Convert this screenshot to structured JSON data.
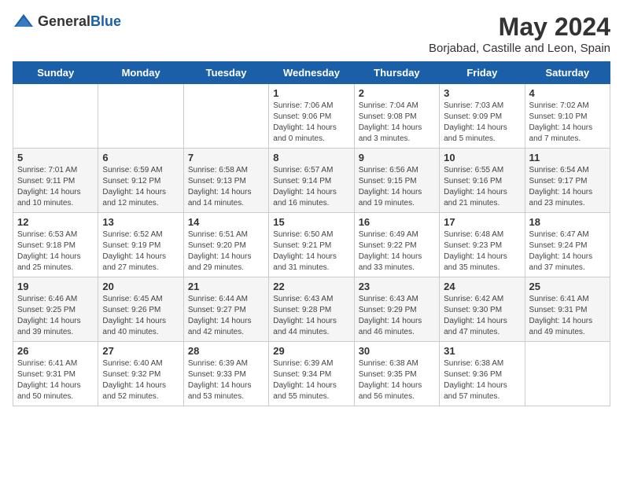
{
  "header": {
    "logo_general": "General",
    "logo_blue": "Blue",
    "month_title": "May 2024",
    "location": "Borjabad, Castille and Leon, Spain"
  },
  "weekdays": [
    "Sunday",
    "Monday",
    "Tuesday",
    "Wednesday",
    "Thursday",
    "Friday",
    "Saturday"
  ],
  "weeks": [
    [
      {
        "day": "",
        "info": ""
      },
      {
        "day": "",
        "info": ""
      },
      {
        "day": "",
        "info": ""
      },
      {
        "day": "1",
        "info": "Sunrise: 7:06 AM\nSunset: 9:06 PM\nDaylight: 14 hours\nand 0 minutes."
      },
      {
        "day": "2",
        "info": "Sunrise: 7:04 AM\nSunset: 9:08 PM\nDaylight: 14 hours\nand 3 minutes."
      },
      {
        "day": "3",
        "info": "Sunrise: 7:03 AM\nSunset: 9:09 PM\nDaylight: 14 hours\nand 5 minutes."
      },
      {
        "day": "4",
        "info": "Sunrise: 7:02 AM\nSunset: 9:10 PM\nDaylight: 14 hours\nand 7 minutes."
      }
    ],
    [
      {
        "day": "5",
        "info": "Sunrise: 7:01 AM\nSunset: 9:11 PM\nDaylight: 14 hours\nand 10 minutes."
      },
      {
        "day": "6",
        "info": "Sunrise: 6:59 AM\nSunset: 9:12 PM\nDaylight: 14 hours\nand 12 minutes."
      },
      {
        "day": "7",
        "info": "Sunrise: 6:58 AM\nSunset: 9:13 PM\nDaylight: 14 hours\nand 14 minutes."
      },
      {
        "day": "8",
        "info": "Sunrise: 6:57 AM\nSunset: 9:14 PM\nDaylight: 14 hours\nand 16 minutes."
      },
      {
        "day": "9",
        "info": "Sunrise: 6:56 AM\nSunset: 9:15 PM\nDaylight: 14 hours\nand 19 minutes."
      },
      {
        "day": "10",
        "info": "Sunrise: 6:55 AM\nSunset: 9:16 PM\nDaylight: 14 hours\nand 21 minutes."
      },
      {
        "day": "11",
        "info": "Sunrise: 6:54 AM\nSunset: 9:17 PM\nDaylight: 14 hours\nand 23 minutes."
      }
    ],
    [
      {
        "day": "12",
        "info": "Sunrise: 6:53 AM\nSunset: 9:18 PM\nDaylight: 14 hours\nand 25 minutes."
      },
      {
        "day": "13",
        "info": "Sunrise: 6:52 AM\nSunset: 9:19 PM\nDaylight: 14 hours\nand 27 minutes."
      },
      {
        "day": "14",
        "info": "Sunrise: 6:51 AM\nSunset: 9:20 PM\nDaylight: 14 hours\nand 29 minutes."
      },
      {
        "day": "15",
        "info": "Sunrise: 6:50 AM\nSunset: 9:21 PM\nDaylight: 14 hours\nand 31 minutes."
      },
      {
        "day": "16",
        "info": "Sunrise: 6:49 AM\nSunset: 9:22 PM\nDaylight: 14 hours\nand 33 minutes."
      },
      {
        "day": "17",
        "info": "Sunrise: 6:48 AM\nSunset: 9:23 PM\nDaylight: 14 hours\nand 35 minutes."
      },
      {
        "day": "18",
        "info": "Sunrise: 6:47 AM\nSunset: 9:24 PM\nDaylight: 14 hours\nand 37 minutes."
      }
    ],
    [
      {
        "day": "19",
        "info": "Sunrise: 6:46 AM\nSunset: 9:25 PM\nDaylight: 14 hours\nand 39 minutes."
      },
      {
        "day": "20",
        "info": "Sunrise: 6:45 AM\nSunset: 9:26 PM\nDaylight: 14 hours\nand 40 minutes."
      },
      {
        "day": "21",
        "info": "Sunrise: 6:44 AM\nSunset: 9:27 PM\nDaylight: 14 hours\nand 42 minutes."
      },
      {
        "day": "22",
        "info": "Sunrise: 6:43 AM\nSunset: 9:28 PM\nDaylight: 14 hours\nand 44 minutes."
      },
      {
        "day": "23",
        "info": "Sunrise: 6:43 AM\nSunset: 9:29 PM\nDaylight: 14 hours\nand 46 minutes."
      },
      {
        "day": "24",
        "info": "Sunrise: 6:42 AM\nSunset: 9:30 PM\nDaylight: 14 hours\nand 47 minutes."
      },
      {
        "day": "25",
        "info": "Sunrise: 6:41 AM\nSunset: 9:31 PM\nDaylight: 14 hours\nand 49 minutes."
      }
    ],
    [
      {
        "day": "26",
        "info": "Sunrise: 6:41 AM\nSunset: 9:31 PM\nDaylight: 14 hours\nand 50 minutes."
      },
      {
        "day": "27",
        "info": "Sunrise: 6:40 AM\nSunset: 9:32 PM\nDaylight: 14 hours\nand 52 minutes."
      },
      {
        "day": "28",
        "info": "Sunrise: 6:39 AM\nSunset: 9:33 PM\nDaylight: 14 hours\nand 53 minutes."
      },
      {
        "day": "29",
        "info": "Sunrise: 6:39 AM\nSunset: 9:34 PM\nDaylight: 14 hours\nand 55 minutes."
      },
      {
        "day": "30",
        "info": "Sunrise: 6:38 AM\nSunset: 9:35 PM\nDaylight: 14 hours\nand 56 minutes."
      },
      {
        "day": "31",
        "info": "Sunrise: 6:38 AM\nSunset: 9:36 PM\nDaylight: 14 hours\nand 57 minutes."
      },
      {
        "day": "",
        "info": ""
      }
    ]
  ]
}
